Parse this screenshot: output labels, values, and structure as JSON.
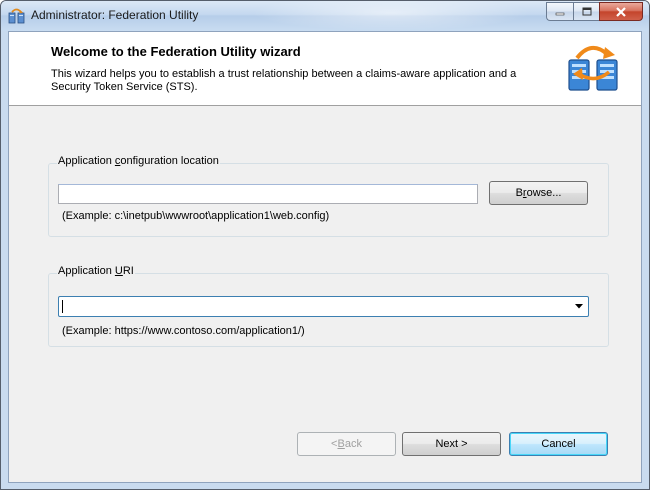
{
  "window": {
    "title": "Administrator: Federation Utility"
  },
  "header": {
    "title": "Welcome to the Federation Utility wizard",
    "description": "This wizard helps you to establish a trust relationship between a claims-aware application and a Security Token Service (STS)."
  },
  "app_config": {
    "label_pre": "Application ",
    "label_access": "c",
    "label_post": "onfiguration location",
    "value": "",
    "browse_pre": "B",
    "browse_access": "r",
    "browse_post": "owse...",
    "example": "(Example: c:\\inetpub\\wwwroot\\application1\\web.config)"
  },
  "app_uri": {
    "label_pre": "Application ",
    "label_access": "U",
    "label_post": "RI",
    "value": "",
    "example": "(Example: https://www.contoso.com/application1/)"
  },
  "footer": {
    "back_pre": "< ",
    "back_access": "B",
    "back_post": "ack",
    "next_label": "Next >",
    "cancel_label": "Cancel"
  },
  "colors": {
    "titlebar": "#c4d8ef",
    "client_bg": "#f0f0f0",
    "close_button": "#c4452c",
    "focus_border": "#3c7fb1"
  },
  "icons": {
    "app": "federation-utility-icon",
    "header": "federation-servers-icon"
  }
}
